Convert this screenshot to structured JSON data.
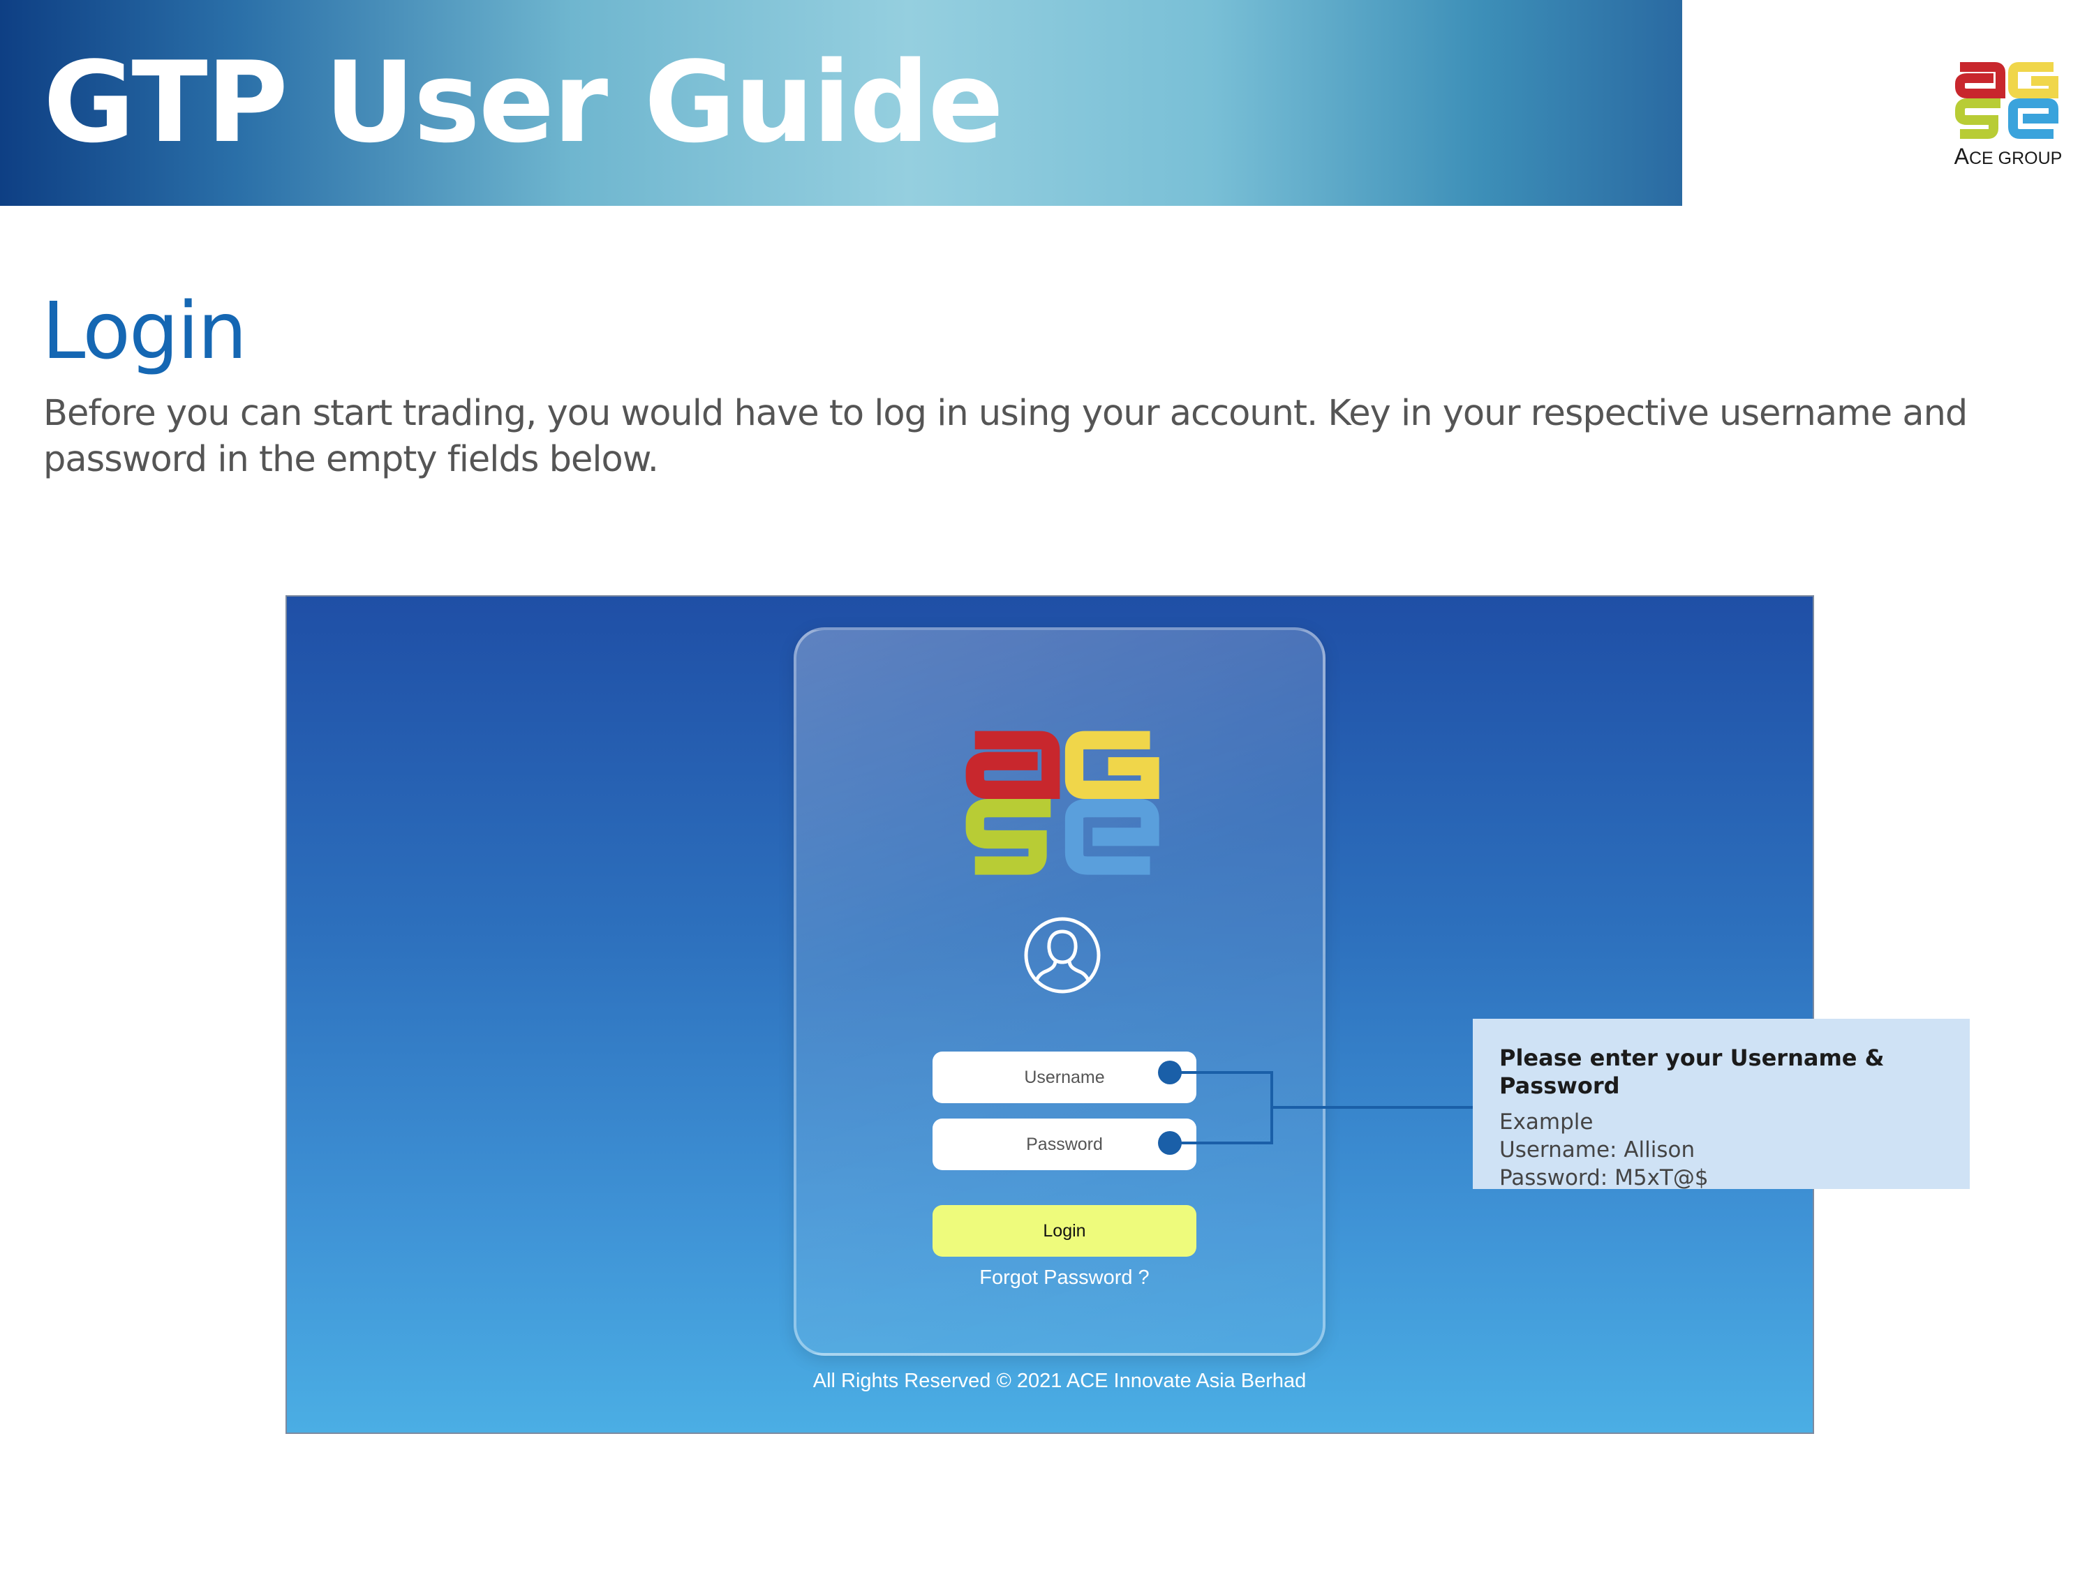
{
  "header": {
    "title": "GTP User Guide",
    "brand_caption_initial": "A",
    "brand_caption_rest": "CE GROUP"
  },
  "section": {
    "title": "Login",
    "intro": "Before you can start trading, you would have to log in using your account. Key in your respective username and password in the empty fields below."
  },
  "login_screen": {
    "username_placeholder": "Username",
    "password_placeholder": "Password",
    "login_button": "Login",
    "forgot_password": "Forgot Password ?",
    "copyright": "All Rights Reserved © 2021 ACE Innovate Asia Berhad"
  },
  "callout": {
    "title": "Please enter your Username & Password",
    "line1": "Example",
    "line2": "Username: Allison",
    "line3": "Password: M5xT@$"
  },
  "colors": {
    "header_dark": "#0e3f84",
    "header_light": "#95cfdf",
    "section_title": "#1567b3",
    "callout_bg": "#cfe2f5",
    "connector": "#1a5fa8",
    "login_button": "#eefb7c",
    "logo_red": "#c8272d",
    "logo_yellow": "#f0d64a",
    "logo_green": "#b8cc35",
    "logo_blue": "#3aa3dc"
  }
}
